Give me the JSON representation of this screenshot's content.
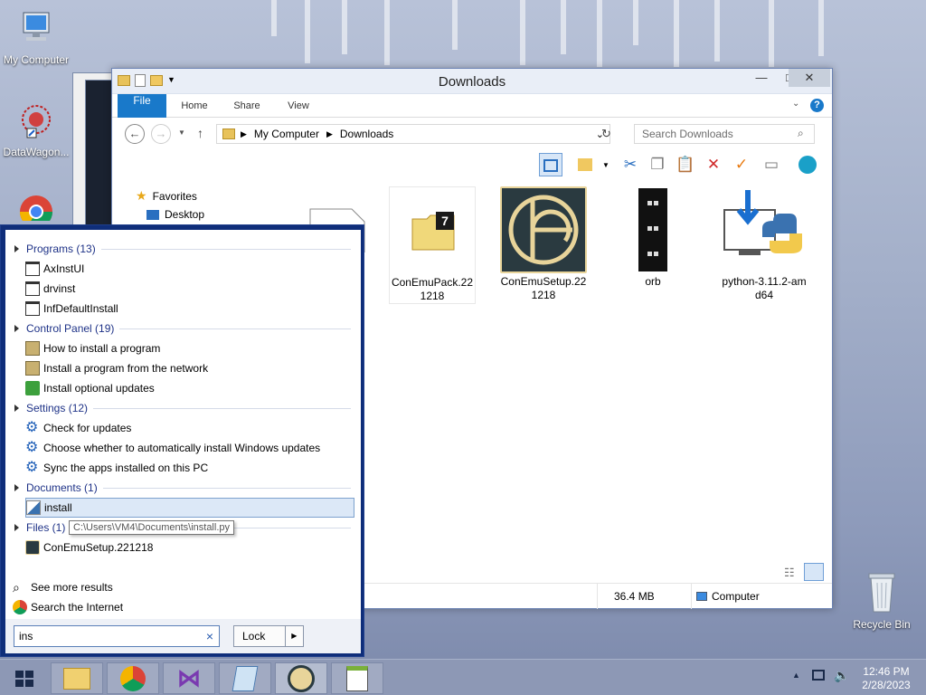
{
  "desktop": {
    "icons": [
      {
        "label": "My Computer"
      },
      {
        "label": "DataWagon..."
      },
      {
        "label": "Recycle Bin"
      }
    ]
  },
  "explorer": {
    "title": "Downloads",
    "minimize": "—",
    "maximize": "□",
    "close": "✕",
    "ribbon_tabs": [
      "File",
      "Home",
      "Share",
      "View"
    ],
    "path": [
      "My Computer",
      "Downloads"
    ],
    "search_placeholder": "Search Downloads",
    "nav": {
      "favorites": "Favorites",
      "desktop": "Desktop"
    },
    "files": [
      {
        "name": "ConEmuPack.221218"
      },
      {
        "name": "ConEmuSetup.221218"
      },
      {
        "name": "orb"
      },
      {
        "name": "python-3.11.2-amd64"
      }
    ],
    "status": {
      "size": "36.4 MB",
      "location": "Computer"
    }
  },
  "search": {
    "groups": [
      {
        "label": "Programs (13)",
        "items": [
          "AxInstUI",
          "drvinst",
          "InfDefaultInstall"
        ]
      },
      {
        "label": "Control Panel (19)",
        "items": [
          "How to install a program",
          "Install a program from the network",
          "Install optional updates"
        ]
      },
      {
        "label": "Settings (12)",
        "items": [
          "Check for updates",
          "Choose whether to automatically install Windows updates",
          "Sync the apps installed on this PC"
        ]
      },
      {
        "label": "Documents (1)",
        "items": [
          "install"
        ]
      },
      {
        "label": "Files (1)",
        "items": [
          "ConEmuSetup.221218"
        ]
      }
    ],
    "tooltip": "C:\\Users\\VM4\\Documents\\install.py",
    "see_more": "See more results",
    "search_internet": "Search the Internet",
    "query": "ins",
    "clear": "×",
    "lock_label": "Lock",
    "lock_arrow": "▶"
  },
  "taskbar": {
    "time": "12:46 PM",
    "date": "2/28/2023"
  }
}
